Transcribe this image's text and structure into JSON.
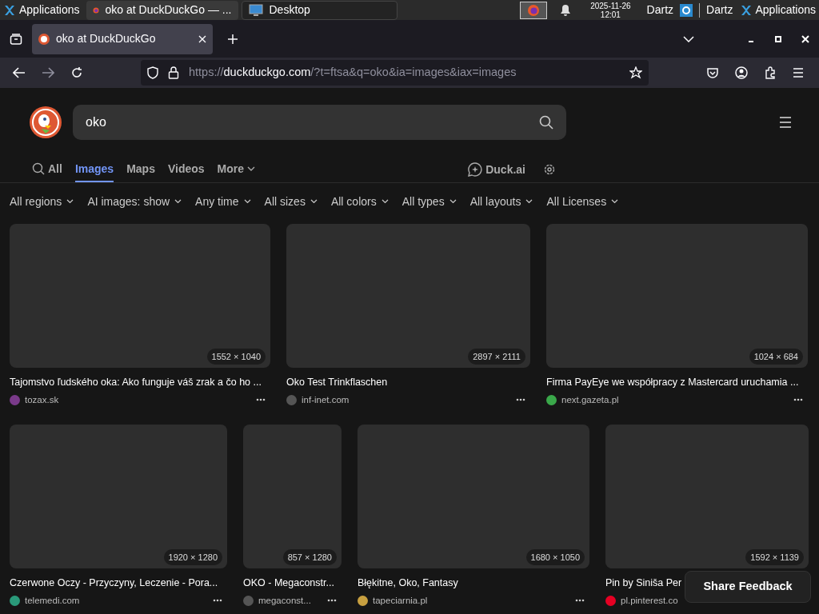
{
  "taskbar": {
    "apps_label": "Applications",
    "tasks": [
      {
        "label": "oko at DuckDuckGo — ...",
        "kind": "firefox",
        "selected": true
      },
      {
        "label": "Desktop",
        "kind": "desktop",
        "selected": false
      }
    ],
    "date": "2025-11-26",
    "time": "12:01",
    "user": "Dartz",
    "user2": "Dartz",
    "apps_label2": "Applications"
  },
  "browser": {
    "tabs": [
      {
        "title": "oko at DuckDuckGo",
        "selected": true
      }
    ],
    "url_host": "https://duckduckgo.com",
    "url_rest": "/?t=ftsa&q=oko&ia=images&iax=images"
  },
  "search": {
    "value": "oko"
  },
  "nav": [
    {
      "label": "All",
      "selected": false
    },
    {
      "label": "Images",
      "selected": true
    },
    {
      "label": "Maps",
      "selected": false
    },
    {
      "label": "Videos",
      "selected": false
    },
    {
      "label": "More",
      "selected": false
    }
  ],
  "duck_ai": "Duck.ai",
  "filters": [
    "All regions",
    "AI images: show",
    "Any time",
    "All sizes",
    "All colors",
    "All types",
    "All layouts",
    "All Licenses"
  ],
  "rows": [
    [
      {
        "size": "1552 × 1040",
        "title": "Tajomstvo ľudského oka: Ako funguje váš zrak a čo ho ...",
        "source": "tozax.sk",
        "color": "#7a3a8a"
      },
      {
        "size": "2897 × 2111",
        "title": "Oko Test Trinkflaschen",
        "source": "inf-inet.com",
        "color": "#555555"
      },
      {
        "size": "1024 × 684",
        "title": "Firma PayEye we współpracy z Mastercard uruchamia ...",
        "source": "next.gazeta.pl",
        "color": "#3aa84a"
      }
    ],
    [
      {
        "size": "1920 × 1280",
        "title": "Czerwone Oczy - Przyczyny, Leczenie - Pora...",
        "source": "telemedi.com",
        "color": "#2a9a7a"
      },
      {
        "size": "857 × 1280",
        "title": "OKO - Megaconstr...",
        "source": "megaconst...",
        "color": "#555555"
      },
      {
        "size": "1680 × 1050",
        "title": "Błękitne, Oko, Fantasy",
        "source": "tapeciarnia.pl",
        "color": "#c8a040"
      },
      {
        "size": "1592 × 1139",
        "title": "Pin by Siniša Per",
        "source": "pl.pinterest.co",
        "color": "#e60023"
      }
    ]
  ],
  "feedback_button": "Share Feedback"
}
